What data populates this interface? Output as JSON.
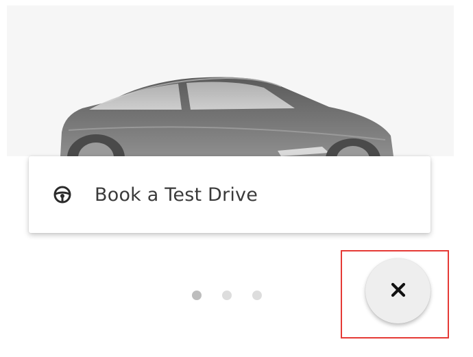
{
  "hero": {
    "image": "car-image"
  },
  "menu": {
    "items": [
      {
        "label": "Book a Test Drive",
        "icon": "steering-wheel-icon"
      }
    ]
  },
  "pagination": {
    "total": 3,
    "active_index": 0
  },
  "close_button": {
    "icon": "close-icon"
  },
  "colors": {
    "highlight": "#e53935",
    "fab_background": "#eeeeee",
    "dot_active": "#bdbdbd",
    "dot_inactive": "#dddddd"
  }
}
